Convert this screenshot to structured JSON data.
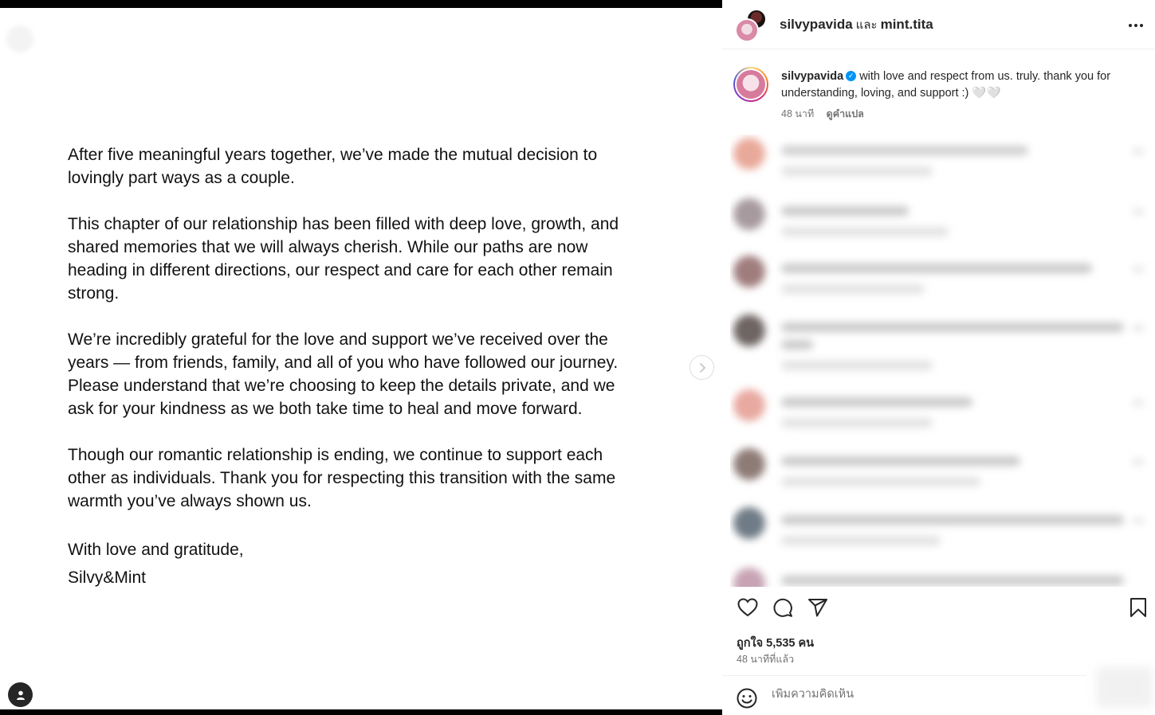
{
  "media": {
    "paragraphs": [
      "After five meaningful years together, we’ve made the mutual decision to\nlovingly part ways as a couple.",
      "This chapter of our relationship has been filled with deep love, growth, and\nshared memories that we will always cherish. While our paths are now\nheading in different directions, our respect and care for each other remain\nstrong.",
      "We’re incredibly grateful for the love and support we’ve received over the\nyears — from friends, family, and all of you who have followed our journey.\nPlease understand that we’re choosing to keep the details private, and we\nask for your kindness as we both take time to heal and move forward.",
      "Though our romantic relationship is ending, we continue to support each\nother as individuals. Thank you for respecting this transition with the same\nwarmth you’ve always shown us."
    ],
    "closing": "With love and gratitude,",
    "signature": "Silvy&Mint",
    "next_icon": "chevron-right-icon",
    "tag_icon": "user-tag-icon"
  },
  "header": {
    "user1": "silvypavida",
    "and_word": "และ",
    "user2": "mint.tita",
    "more_icon": "more-icon",
    "more_label": "···"
  },
  "caption": {
    "username": "silvypavida",
    "verified_icon": "verified-badge-icon",
    "text": "with love and respect from us. truly. thank you for understanding, loving, and support :) 🤍🤍",
    "time": "48 นาที",
    "translate": "ดูคำแปล"
  },
  "actions": {
    "like_icon": "heart-icon",
    "comment_icon": "comment-icon",
    "share_icon": "share-icon",
    "save_icon": "bookmark-icon",
    "likes": "ถูกใจ 5,535 คน",
    "time_ago": "48 นาทีที่แล้ว"
  },
  "comment_box": {
    "emoji_icon": "emoji-icon",
    "placeholder": "เพิ่มความคิดเห็น"
  },
  "colors": {
    "accent": "#0095f6",
    "text": "#262626",
    "muted": "#737373"
  }
}
